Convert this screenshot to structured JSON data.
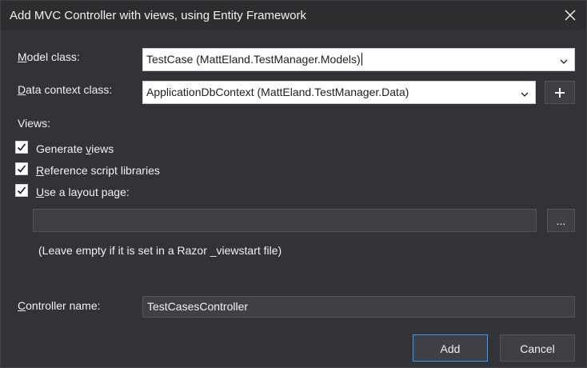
{
  "window": {
    "title": "Add MVC Controller with views, using Entity Framework"
  },
  "form": {
    "model_class": {
      "label_prefix": "",
      "label_access": "M",
      "label_rest": "odel class:",
      "value": "TestCase (MattEland.TestManager.Models)"
    },
    "data_context_class": {
      "label_access": "D",
      "label_rest": "ata context class:",
      "value": "ApplicationDbContext (MattEland.TestManager.Data)",
      "add_button_label": "+"
    },
    "views_label": "Views:",
    "generate_views": {
      "prefix": "Generate ",
      "access": "v",
      "rest": "iews",
      "checked": true
    },
    "reference_scripts": {
      "prefix": "",
      "access": "R",
      "rest": "eference script libraries",
      "checked": true
    },
    "use_layout": {
      "prefix": "",
      "access": "U",
      "rest": "se a layout page:",
      "checked": true
    },
    "layout_path": {
      "value": ""
    },
    "browse_label": "...",
    "layout_hint": "(Leave empty if it is set in a Razor _viewstart file)",
    "controller_name": {
      "label_access": "C",
      "label_rest": "ontroller name:",
      "value": "TestCasesController"
    }
  },
  "buttons": {
    "add": "Add",
    "cancel": "Cancel"
  },
  "colors": {
    "background": "#2d2d30",
    "panel": "#333337",
    "accent": "#3399ff",
    "field": "#3f3f46"
  }
}
